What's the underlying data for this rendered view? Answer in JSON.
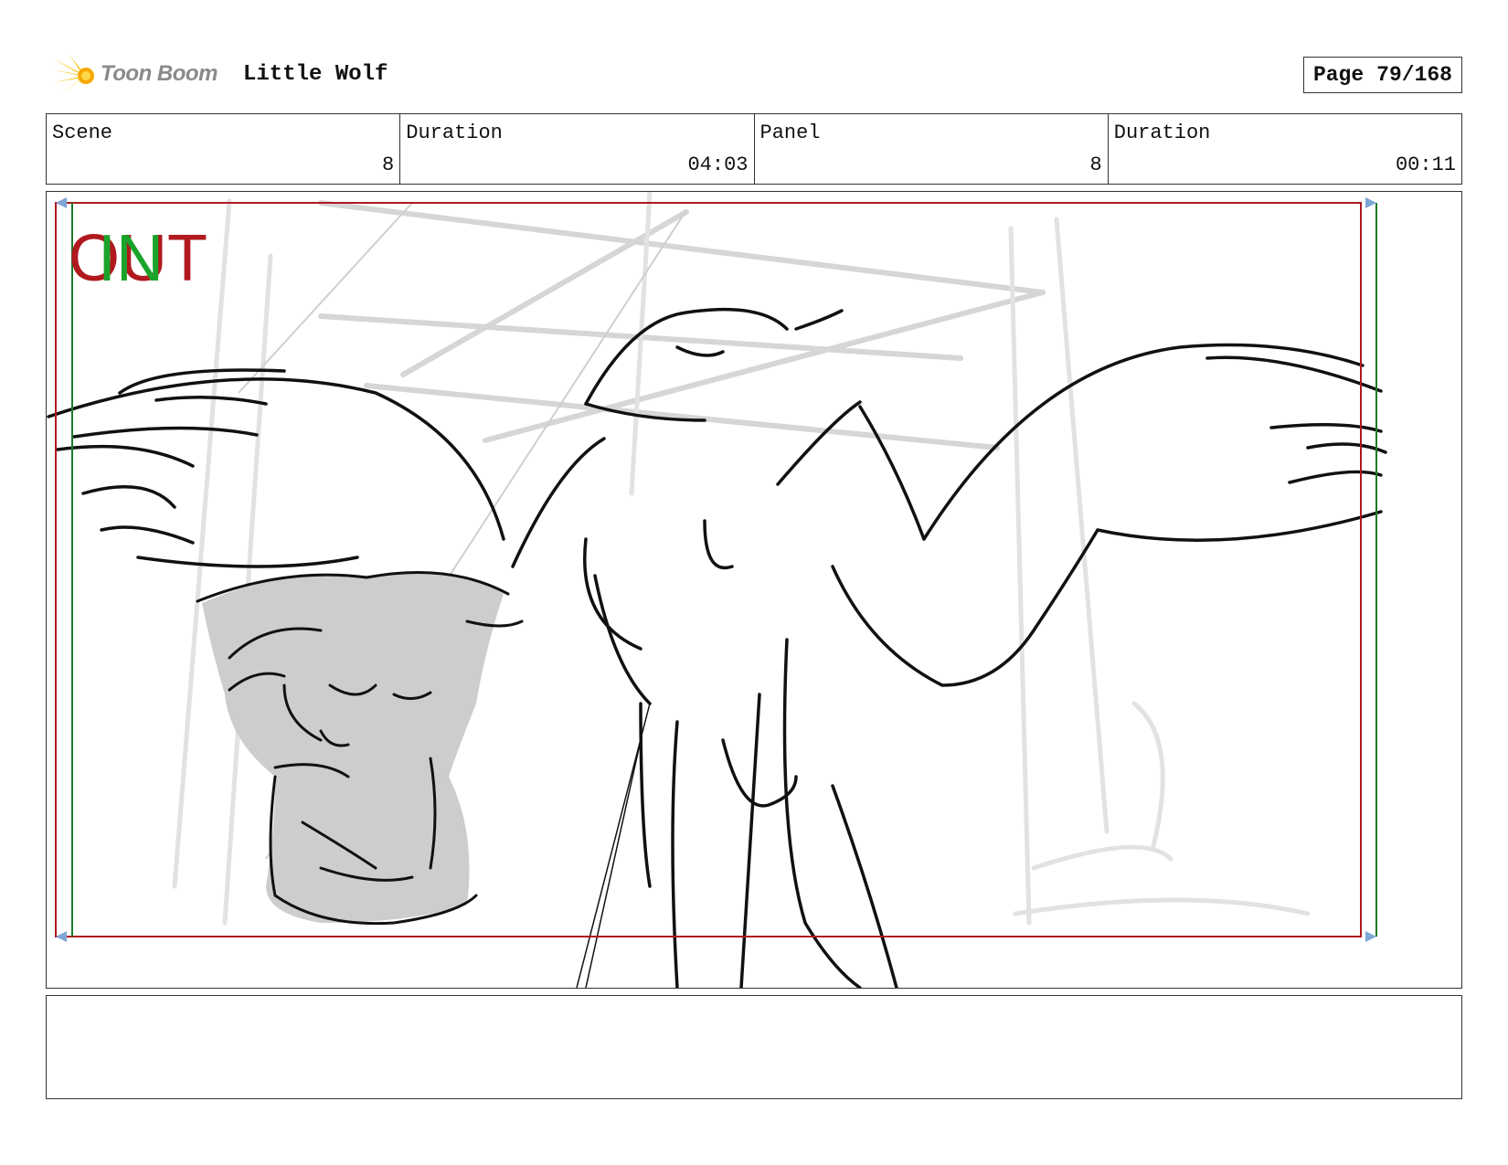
{
  "header": {
    "brand": "Toon Boom",
    "project_title": "Little Wolf",
    "page_label": "Page",
    "page_value": "79/168"
  },
  "info": {
    "scene_label": "Scene",
    "scene_value": "8",
    "scene_duration_label": "Duration",
    "scene_duration_value": "04:03",
    "panel_label": "Panel",
    "panel_value": "8",
    "panel_duration_label": "Duration",
    "panel_duration_value": "00:11"
  },
  "panel": {
    "out_marker": "OUT",
    "in_marker": "IN",
    "colors": {
      "out": "#b0191e",
      "in": "#1aa32a",
      "frame_red": "#b0191e",
      "frame_green": "#1e7a2a"
    }
  },
  "notes": {
    "text": ""
  }
}
